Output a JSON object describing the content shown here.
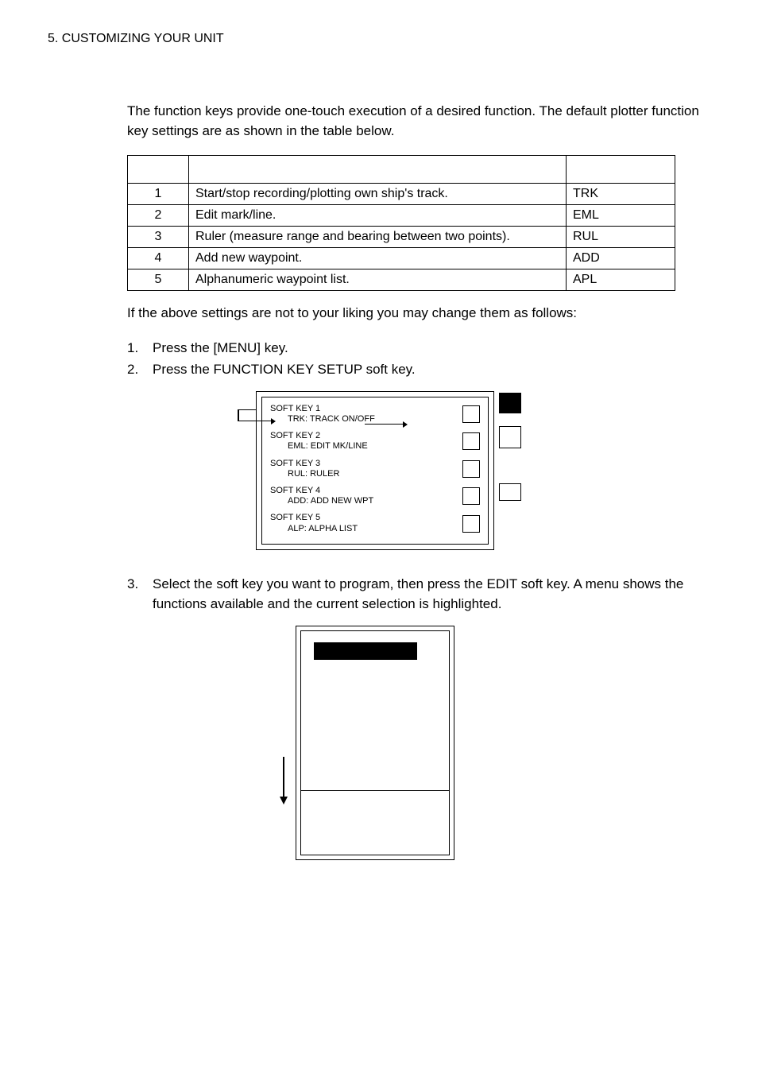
{
  "header": "5. CUSTOMIZING YOUR UNIT",
  "intro": "The function keys provide one-touch execution of a desired function. The default plotter function key settings are as shown in the table below.",
  "table": {
    "rows": [
      {
        "num": "1",
        "func": "Start/stop recording/plotting own ship's track.",
        "label": "TRK"
      },
      {
        "num": "2",
        "func": "Edit mark/line.",
        "label": "EML"
      },
      {
        "num": "3",
        "func": "Ruler (measure range and bearing between two points).",
        "label": "RUL"
      },
      {
        "num": "4",
        "func": "Add new waypoint.",
        "label": "ADD"
      },
      {
        "num": "5",
        "func": "Alphanumeric waypoint list.",
        "label": "APL"
      }
    ]
  },
  "after_table": "If the above settings are not to your liking you may change them as follows:",
  "steps12": [
    {
      "n": "1.",
      "t": "Press the [MENU] key."
    },
    {
      "n": "2.",
      "t": "Press the FUNCTION KEY SETUP soft key."
    }
  ],
  "fig1": {
    "rows": [
      {
        "title": "SOFT KEY 1",
        "sub": "TRK: TRACK ON/OFF"
      },
      {
        "title": "SOFT KEY 2",
        "sub": "EML: EDIT MK/LINE"
      },
      {
        "title": "SOFT KEY 3",
        "sub": "RUL: RULER"
      },
      {
        "title": "SOFT KEY 4",
        "sub": "ADD: ADD NEW WPT"
      },
      {
        "title": "SOFT KEY 5",
        "sub": "ALP: ALPHA LIST"
      }
    ]
  },
  "step3": {
    "n": "3.",
    "t": "Select the soft key you want to program, then press the EDIT soft key. A menu shows the functions available and the current selection is highlighted."
  },
  "down_arrow": "↓"
}
